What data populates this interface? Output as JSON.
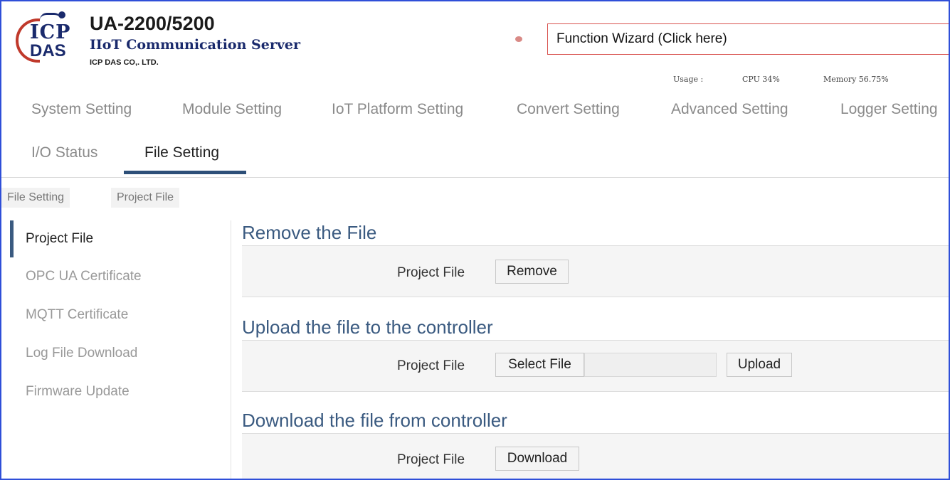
{
  "header": {
    "logo_icp": "ICP",
    "logo_das": "DAS",
    "product": "UA-2200/5200",
    "subtitle": "IIoT Communication Server",
    "company": "ICP DAS CO,. LTD.",
    "wizard": "Function Wizard  (Click here)",
    "usage_label": "Usage :",
    "cpu": "CPU  34%",
    "memory": "Memory  56.75%"
  },
  "nav": {
    "row1": [
      "System Setting",
      "Module Setting",
      "IoT Platform Setting",
      "Convert Setting",
      "Advanced Setting",
      "Logger Setting"
    ],
    "row2": [
      "I/O Status",
      "File Setting"
    ]
  },
  "breadcrumb": [
    "File Setting",
    "Project File"
  ],
  "sidebar": [
    "Project File",
    "OPC UA Certificate",
    "MQTT Certificate",
    "Log File Download",
    "Firmware Update"
  ],
  "sections": [
    {
      "title": "Remove the File",
      "label": "Project File",
      "button": "Remove"
    },
    {
      "title": "Upload the file to the controller",
      "label": "Project File",
      "select_button": "Select File",
      "button": "Upload"
    },
    {
      "title": "Download the file from controller",
      "label": "Project File",
      "button": "Download"
    }
  ],
  "colors": {
    "accent": "#2d4f78",
    "title": "#3a5a80",
    "wizard_border": "#d9534f",
    "frame": "#2f4fd8"
  }
}
